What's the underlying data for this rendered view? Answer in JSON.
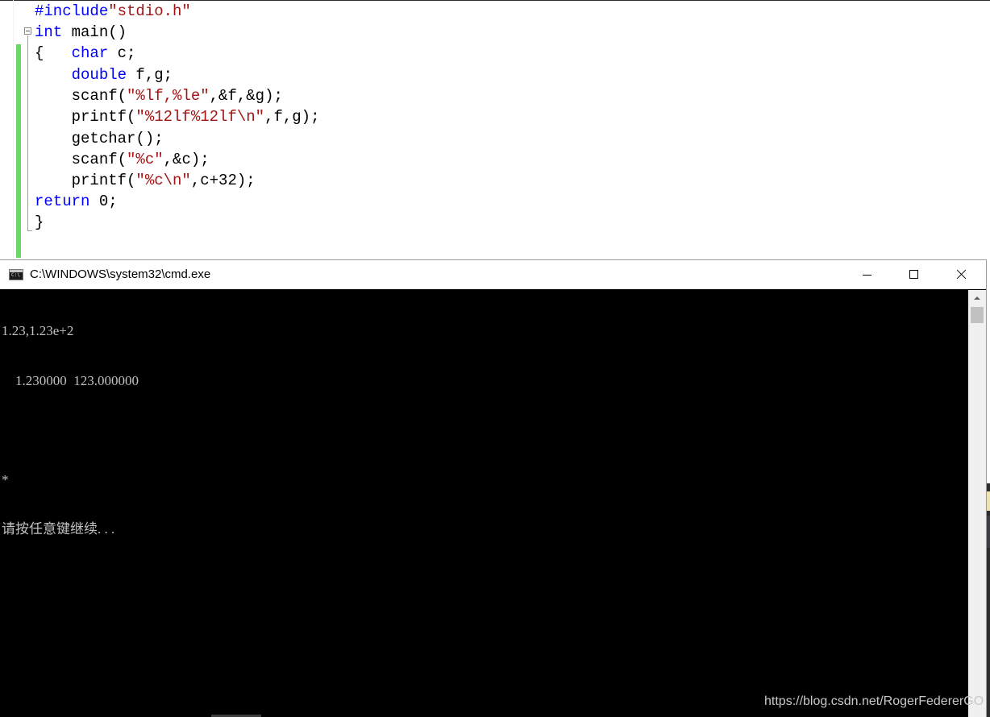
{
  "editor": {
    "lines": [
      {
        "id": "include",
        "parts": [
          {
            "t": "#include",
            "c": "pp"
          },
          {
            "t": "\"stdio.h\"",
            "c": "str"
          }
        ]
      },
      {
        "id": "main",
        "parts": [
          {
            "t": "int",
            "c": "kw"
          },
          {
            "t": " main()",
            "c": ""
          }
        ]
      },
      {
        "id": "brace-open",
        "parts": [
          {
            "t": "{   ",
            "c": ""
          },
          {
            "t": "char",
            "c": "kw"
          },
          {
            "t": " c;",
            "c": ""
          }
        ]
      },
      {
        "id": "double",
        "parts": [
          {
            "t": "    ",
            "c": ""
          },
          {
            "t": "double",
            "c": "kw"
          },
          {
            "t": " f,g;",
            "c": ""
          }
        ]
      },
      {
        "id": "scanf-1",
        "parts": [
          {
            "t": "    scanf(",
            "c": ""
          },
          {
            "t": "\"%lf,%le\"",
            "c": "str"
          },
          {
            "t": ",&f,&g);",
            "c": ""
          }
        ]
      },
      {
        "id": "printf-1",
        "parts": [
          {
            "t": "    printf(",
            "c": ""
          },
          {
            "t": "\"%12lf%12lf\\n\"",
            "c": "str"
          },
          {
            "t": ",f,g);",
            "c": ""
          }
        ]
      },
      {
        "id": "getchar",
        "parts": [
          {
            "t": "    getchar();",
            "c": ""
          }
        ]
      },
      {
        "id": "scanf-2",
        "parts": [
          {
            "t": "    scanf(",
            "c": ""
          },
          {
            "t": "\"%c\"",
            "c": "str"
          },
          {
            "t": ",&c);",
            "c": ""
          }
        ]
      },
      {
        "id": "printf-2",
        "parts": [
          {
            "t": "    printf(",
            "c": ""
          },
          {
            "t": "\"%c\\n\"",
            "c": "str"
          },
          {
            "t": ",c+32);",
            "c": ""
          }
        ]
      },
      {
        "id": "return",
        "parts": [
          {
            "t": "return",
            "c": "kw"
          },
          {
            "t": " 0;",
            "c": ""
          }
        ]
      },
      {
        "id": "brace-close",
        "parts": [
          {
            "t": "}",
            "c": ""
          }
        ]
      }
    ]
  },
  "console": {
    "title": "C:\\WINDOWS\\system32\\cmd.exe",
    "icon": "cmd-icon",
    "icon_text": "C:\\",
    "buttons": {
      "minimize": "minimize-icon",
      "maximize": "maximize-icon",
      "close": "close-icon"
    },
    "output": [
      "1.23,1.23e+2",
      "    1.230000  123.000000",
      "",
      "*",
      "请按任意键继续. . ."
    ]
  },
  "watermark": "https://blog.csdn.net/RogerFedererGO",
  "colors": {
    "keyword": "#0000ff",
    "string": "#a31515",
    "console_bg": "#000000",
    "console_text": "#c0c0c0",
    "gutter_change": "#6bd66b"
  }
}
